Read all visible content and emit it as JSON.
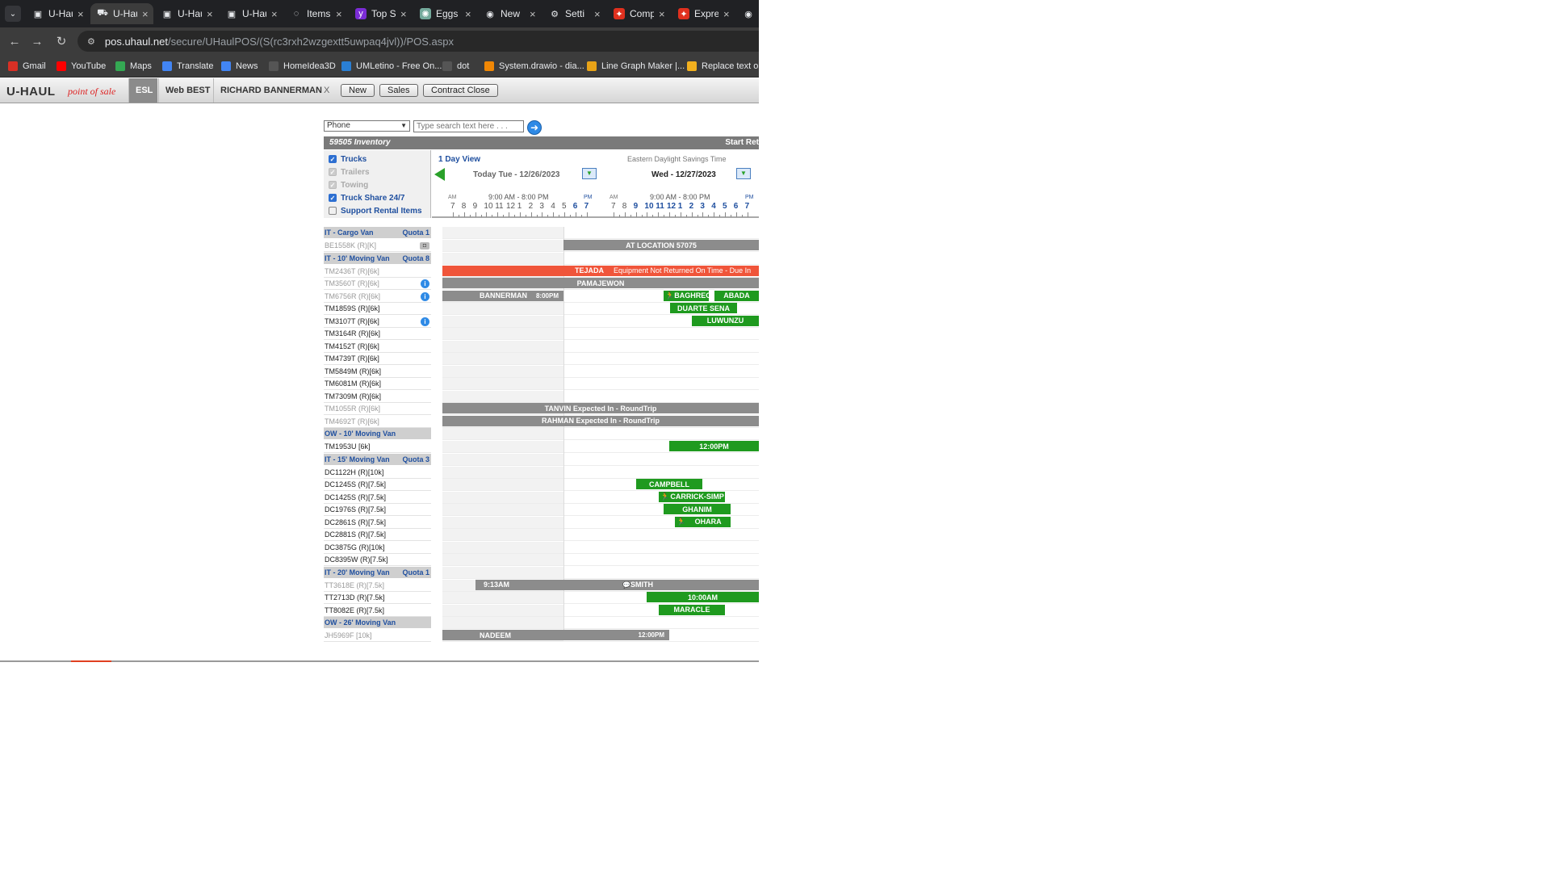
{
  "browser": {
    "tabs": [
      {
        "title": "U-Haul",
        "icon": "uhaul-icon"
      },
      {
        "title": "U-Haul",
        "icon": "uhaul-truck-icon"
      },
      {
        "title": "U-Haul",
        "icon": "uhaul-icon"
      },
      {
        "title": "U-Haul",
        "icon": "uhaul-icon"
      },
      {
        "title": "Items",
        "icon": "loading-icon"
      },
      {
        "title": "Top S",
        "icon": "yahoo-icon"
      },
      {
        "title": "Eggs",
        "icon": "chatgpt-icon"
      },
      {
        "title": "New",
        "icon": "chrome-icon"
      },
      {
        "title": "Setti",
        "icon": "gear-icon"
      },
      {
        "title": "Comp",
        "icon": "maple-leaf-icon"
      },
      {
        "title": "Expre",
        "icon": "maple-leaf-icon"
      },
      {
        "title": "",
        "icon": "chrome-icon"
      }
    ],
    "url_host": "pos.uhaul.net",
    "url_path": "/secure/UHaulPOS/(S(rc3rxh2wzgextt5uwpaq4jvl))/POS.aspx",
    "bookmarks": [
      {
        "label": "Gmail",
        "color": "#d93025"
      },
      {
        "label": "YouTube",
        "color": "#ff0000"
      },
      {
        "label": "Maps",
        "color": "#34a853"
      },
      {
        "label": "Translate",
        "color": "#4285f4"
      },
      {
        "label": "News",
        "color": "#4285f4"
      },
      {
        "label": "HomeIdea3D",
        "color": "#555555"
      },
      {
        "label": "UMLetino - Free On...",
        "color": "#2a7fd4"
      },
      {
        "label": "dot",
        "color": "#555555"
      },
      {
        "label": "System.drawio - dia...",
        "color": "#f08705"
      },
      {
        "label": "Line Graph Maker |...",
        "color": "#e8a317"
      },
      {
        "label": "Replace text onli",
        "color": "#f2b01e"
      }
    ]
  },
  "app": {
    "logo": "U-HAUL",
    "logo_sub": "point of sale",
    "tabs": [
      "ESL",
      "Web BEST",
      "RICHARD BANNERMAN"
    ],
    "close_label": "X",
    "buttons": [
      "New",
      "Sales",
      "Contract Close"
    ]
  },
  "search": {
    "type_selected": "Phone",
    "placeholder": "Type search text here . . ."
  },
  "inventory": {
    "title": "59505 Inventory",
    "right_label": "Start Ret"
  },
  "filters": [
    {
      "label": "Trucks",
      "state": "checked"
    },
    {
      "label": "Trailers",
      "state": "disabled"
    },
    {
      "label": "Towing",
      "state": "disabled"
    },
    {
      "label": "Truck Share 24/7",
      "state": "checked"
    },
    {
      "label": "Support Rental Items",
      "state": "unchecked"
    }
  ],
  "timeline": {
    "view": "1 Day View",
    "timezone": "Eastern Daylight Savings Time",
    "today": "Today Tue - 12/26/2023",
    "next": "Wed - 12/27/2023",
    "hours_range": "9:00 AM - 8:00 PM",
    "am": "AM",
    "pm": "PM",
    "day1_ticks": [
      "7",
      "8",
      "9",
      "10",
      "11",
      "12",
      "1",
      "2",
      "3",
      "4",
      "5",
      "6",
      "7"
    ],
    "day2_ticks": [
      "7",
      "8",
      "9",
      "10",
      "11",
      "12",
      "1",
      "2",
      "3",
      "4",
      "5",
      "6",
      "7"
    ]
  },
  "left_rows": [
    {
      "kind": "group",
      "label": "IT - Cargo Van",
      "quota": "Quota 1"
    },
    {
      "kind": "unit",
      "label": "BE1558K (R)[K]",
      "dim": true,
      "badge": "camera"
    },
    {
      "kind": "group",
      "label": "IT - 10' Moving Van",
      "quota": "Quota 8"
    },
    {
      "kind": "unit",
      "label": "TM2436T (R)[6k]",
      "dim": true
    },
    {
      "kind": "unit",
      "label": "TM3560T (R)[6k]",
      "dim": true,
      "badge": "info"
    },
    {
      "kind": "unit",
      "label": "TM6756R (R)[6k]",
      "dim": true,
      "badge": "info"
    },
    {
      "kind": "unit",
      "label": "TM1859S (R)[6k]"
    },
    {
      "kind": "unit",
      "label": "TM3107T (R)[6k]",
      "badge": "info"
    },
    {
      "kind": "unit",
      "label": "TM3164R (R)[6k]"
    },
    {
      "kind": "unit",
      "label": "TM4152T (R)[6k]"
    },
    {
      "kind": "unit",
      "label": "TM4739T (R)[6k]"
    },
    {
      "kind": "unit",
      "label": "TM5849M (R)[6k]"
    },
    {
      "kind": "unit",
      "label": "TM6081M (R)[6k]"
    },
    {
      "kind": "unit",
      "label": "TM7309M (R)[6k]"
    },
    {
      "kind": "unit",
      "label": "TM1055R (R)[6k]",
      "dim": true
    },
    {
      "kind": "unit",
      "label": "TM4692T (R)[6k]",
      "dim": true
    },
    {
      "kind": "group",
      "label": "OW - 10' Moving Van",
      "quota": ""
    },
    {
      "kind": "unit",
      "label": "TM1953U [6k]"
    },
    {
      "kind": "group",
      "label": "IT - 15' Moving Van",
      "quota": "Quota 3"
    },
    {
      "kind": "unit",
      "label": "DC1122H (R)[10k]"
    },
    {
      "kind": "unit",
      "label": "DC1245S (R)[7.5k]"
    },
    {
      "kind": "unit",
      "label": "DC1425S (R)[7.5k]"
    },
    {
      "kind": "unit",
      "label": "DC1976S (R)[7.5k]"
    },
    {
      "kind": "unit",
      "label": "DC2861S (R)[7.5k]"
    },
    {
      "kind": "unit",
      "label": "DC2881S (R)[7.5k]"
    },
    {
      "kind": "unit",
      "label": "DC3875G (R)[10k]"
    },
    {
      "kind": "unit",
      "label": "DC8395W (R)[7.5k]"
    },
    {
      "kind": "group",
      "label": "IT - 20' Moving Van",
      "quota": "Quota 1"
    },
    {
      "kind": "unit",
      "label": "TT3618E (R)[7.5k]",
      "dim": true
    },
    {
      "kind": "unit",
      "label": "TT2713D (R)[7.5k]"
    },
    {
      "kind": "unit",
      "label": "TT8082E (R)[7.5k]"
    },
    {
      "kind": "group",
      "label": "OW - 26' Moving Van",
      "quota": ""
    },
    {
      "kind": "unit",
      "label": "JH5969F [10k]",
      "dim": true
    }
  ],
  "bars": [
    {
      "label": "AT LOCATION 57075",
      "style": "gray",
      "row": 1
    },
    {
      "label": "TEJADA",
      "extra": "Equipment Not Returned On Time - Due In",
      "style": "red",
      "row": 3
    },
    {
      "label": "PAMAJEWON",
      "style": "gray",
      "row": 4
    },
    {
      "label": "BANNERMAN",
      "time": "8:00PM",
      "style": "gray",
      "row": 5
    },
    {
      "label": "BAGHREG",
      "style": "green",
      "row": 5,
      "icon": "runner-icon"
    },
    {
      "label": "ABADA",
      "style": "green",
      "row": 5
    },
    {
      "label": "DUARTE SENA",
      "style": "green",
      "row": 6
    },
    {
      "label": "LUWUNZU",
      "style": "green",
      "row": 7
    },
    {
      "label": "TANVIN Expected In - RoundTrip",
      "style": "gray",
      "row": 14
    },
    {
      "label": "RAHMAN Expected In - RoundTrip",
      "style": "gray",
      "row": 15
    },
    {
      "label": "12:00PM",
      "style": "green",
      "row": 17
    },
    {
      "label": "CAMPBELL",
      "style": "green",
      "row": 20
    },
    {
      "label": "CARRICK-SIMP",
      "style": "green",
      "row": 21,
      "icon": "runner-icon"
    },
    {
      "label": "GHANIM",
      "style": "green",
      "row": 22
    },
    {
      "label": "OHARA",
      "style": "green",
      "row": 23,
      "icon": "runner-icon"
    },
    {
      "label": "9:13AM",
      "extra": "SMITH",
      "style": "gray",
      "row": 28
    },
    {
      "label": "10:00AM",
      "style": "green",
      "row": 29
    },
    {
      "label": "MARACLE",
      "style": "green",
      "row": 30
    },
    {
      "label": "NADEEM",
      "time": "12:00PM",
      "style": "gray",
      "row": 32
    }
  ]
}
